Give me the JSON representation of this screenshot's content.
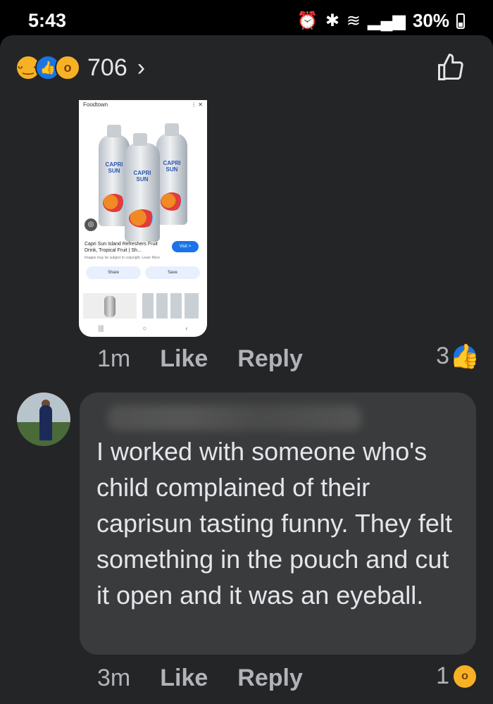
{
  "status_bar": {
    "time": "5:43",
    "battery": "30%"
  },
  "post": {
    "reaction_count": "706",
    "reactions": [
      "haha",
      "like",
      "wow"
    ]
  },
  "shared_image": {
    "source": "Foodtown",
    "bottle_label": "CAPRI SUN",
    "product_title": "Capri Sun Island Refreshers Fruit Drink, Tropical Fruit | Sh...",
    "note": "Images may be subject to copyright. Learn More",
    "visit": "Visit >",
    "share": "Share",
    "save": "Save"
  },
  "comment1": {
    "time": "1m",
    "like": "Like",
    "reply": "Reply",
    "reaction_count": "3",
    "reaction": "like"
  },
  "comment2": {
    "text": "I worked with someone who's child complained of their caprisun tasting funny. They felt something in the pouch and cut it open and it was an eyeball.",
    "time": "3m",
    "like": "Like",
    "reply": "Reply",
    "reaction_count": "1",
    "reaction": "wow"
  }
}
